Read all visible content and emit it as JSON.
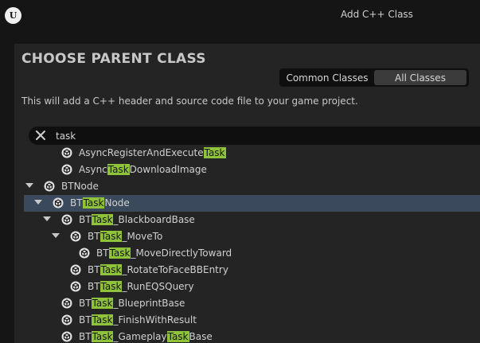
{
  "window": {
    "title": "Add C++ Class",
    "logo_text": "U"
  },
  "heading": "CHOOSE PARENT CLASS",
  "tabs": [
    {
      "label": "Common Classes",
      "active": false
    },
    {
      "label": "All Classes",
      "active": true
    }
  ],
  "description": "This will add a C++ header and source code file to your game project.",
  "search": {
    "value": "task",
    "placeholder": ""
  },
  "colors": {
    "highlight": "#8fc43a",
    "selected_row": "#3a4a5c",
    "panel": "#242424"
  },
  "tree": [
    {
      "parts": [
        "AsyncRegisterAndExecute",
        "Task"
      ],
      "depth": 2,
      "expanded": null,
      "selected": false,
      "icon": "class-icon"
    },
    {
      "parts": [
        "Async",
        "Task",
        "DownloadImage"
      ],
      "depth": 2,
      "expanded": null,
      "selected": false,
      "icon": "class-icon"
    },
    {
      "parts": [
        "BTNode"
      ],
      "depth": 0,
      "expanded": true,
      "selected": false,
      "icon": "class-icon"
    },
    {
      "parts": [
        "BT",
        "Task",
        "Node"
      ],
      "depth": 1,
      "expanded": true,
      "selected": true,
      "icon": "class-icon"
    },
    {
      "parts": [
        "BT",
        "Task",
        "_BlackboardBase"
      ],
      "depth": 2,
      "expanded": true,
      "selected": false,
      "icon": "class-icon"
    },
    {
      "parts": [
        "BT",
        "Task",
        "_MoveTo"
      ],
      "depth": 3,
      "expanded": true,
      "selected": false,
      "icon": "class-icon"
    },
    {
      "parts": [
        "BT",
        "Task",
        "_MoveDirectlyToward"
      ],
      "depth": 4,
      "expanded": null,
      "selected": false,
      "icon": "class-icon"
    },
    {
      "parts": [
        "BT",
        "Task",
        "_RotateToFaceBBEntry"
      ],
      "depth": 3,
      "expanded": null,
      "selected": false,
      "icon": "class-icon"
    },
    {
      "parts": [
        "BT",
        "Task",
        "_RunEQSQuery"
      ],
      "depth": 3,
      "expanded": null,
      "selected": false,
      "icon": "class-icon"
    },
    {
      "parts": [
        "BT",
        "Task",
        "_BlueprintBase"
      ],
      "depth": 2,
      "expanded": null,
      "selected": false,
      "icon": "class-icon"
    },
    {
      "parts": [
        "BT",
        "Task",
        "_FinishWithResult"
      ],
      "depth": 2,
      "expanded": null,
      "selected": false,
      "icon": "class-icon"
    },
    {
      "parts": [
        "BT",
        "Task",
        "_Gameplay",
        "Task",
        "Base"
      ],
      "depth": 2,
      "expanded": null,
      "selected": false,
      "icon": "class-icon"
    }
  ]
}
